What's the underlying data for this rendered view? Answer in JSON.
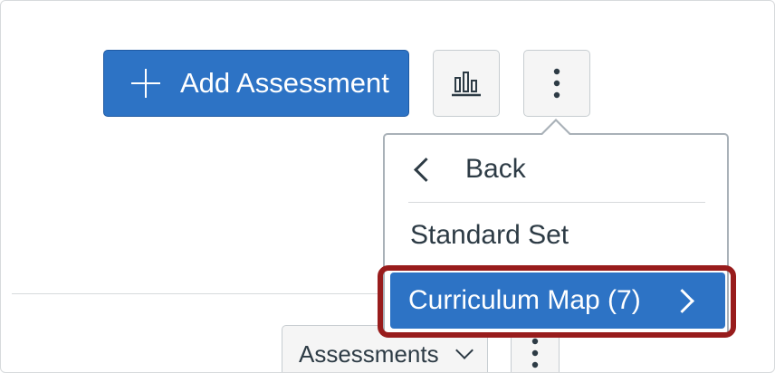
{
  "toolbar": {
    "add_assessment_label": "Add Assessment",
    "stats_icon": "bar-chart-icon",
    "more_icon": "kebab-icon"
  },
  "lower_toolbar": {
    "assessments_label": "Assessments",
    "dropdown_icon": "chevron-down-icon",
    "more_icon": "kebab-icon"
  },
  "menu": {
    "back_label": "Back",
    "items": [
      {
        "label": "Standard Set"
      },
      {
        "label": "Curriculum Map (7)",
        "highlighted": true
      }
    ]
  },
  "colors": {
    "primary": "#2d73c5",
    "highlight_border": "#981c1c",
    "text": "#2d3b45"
  }
}
